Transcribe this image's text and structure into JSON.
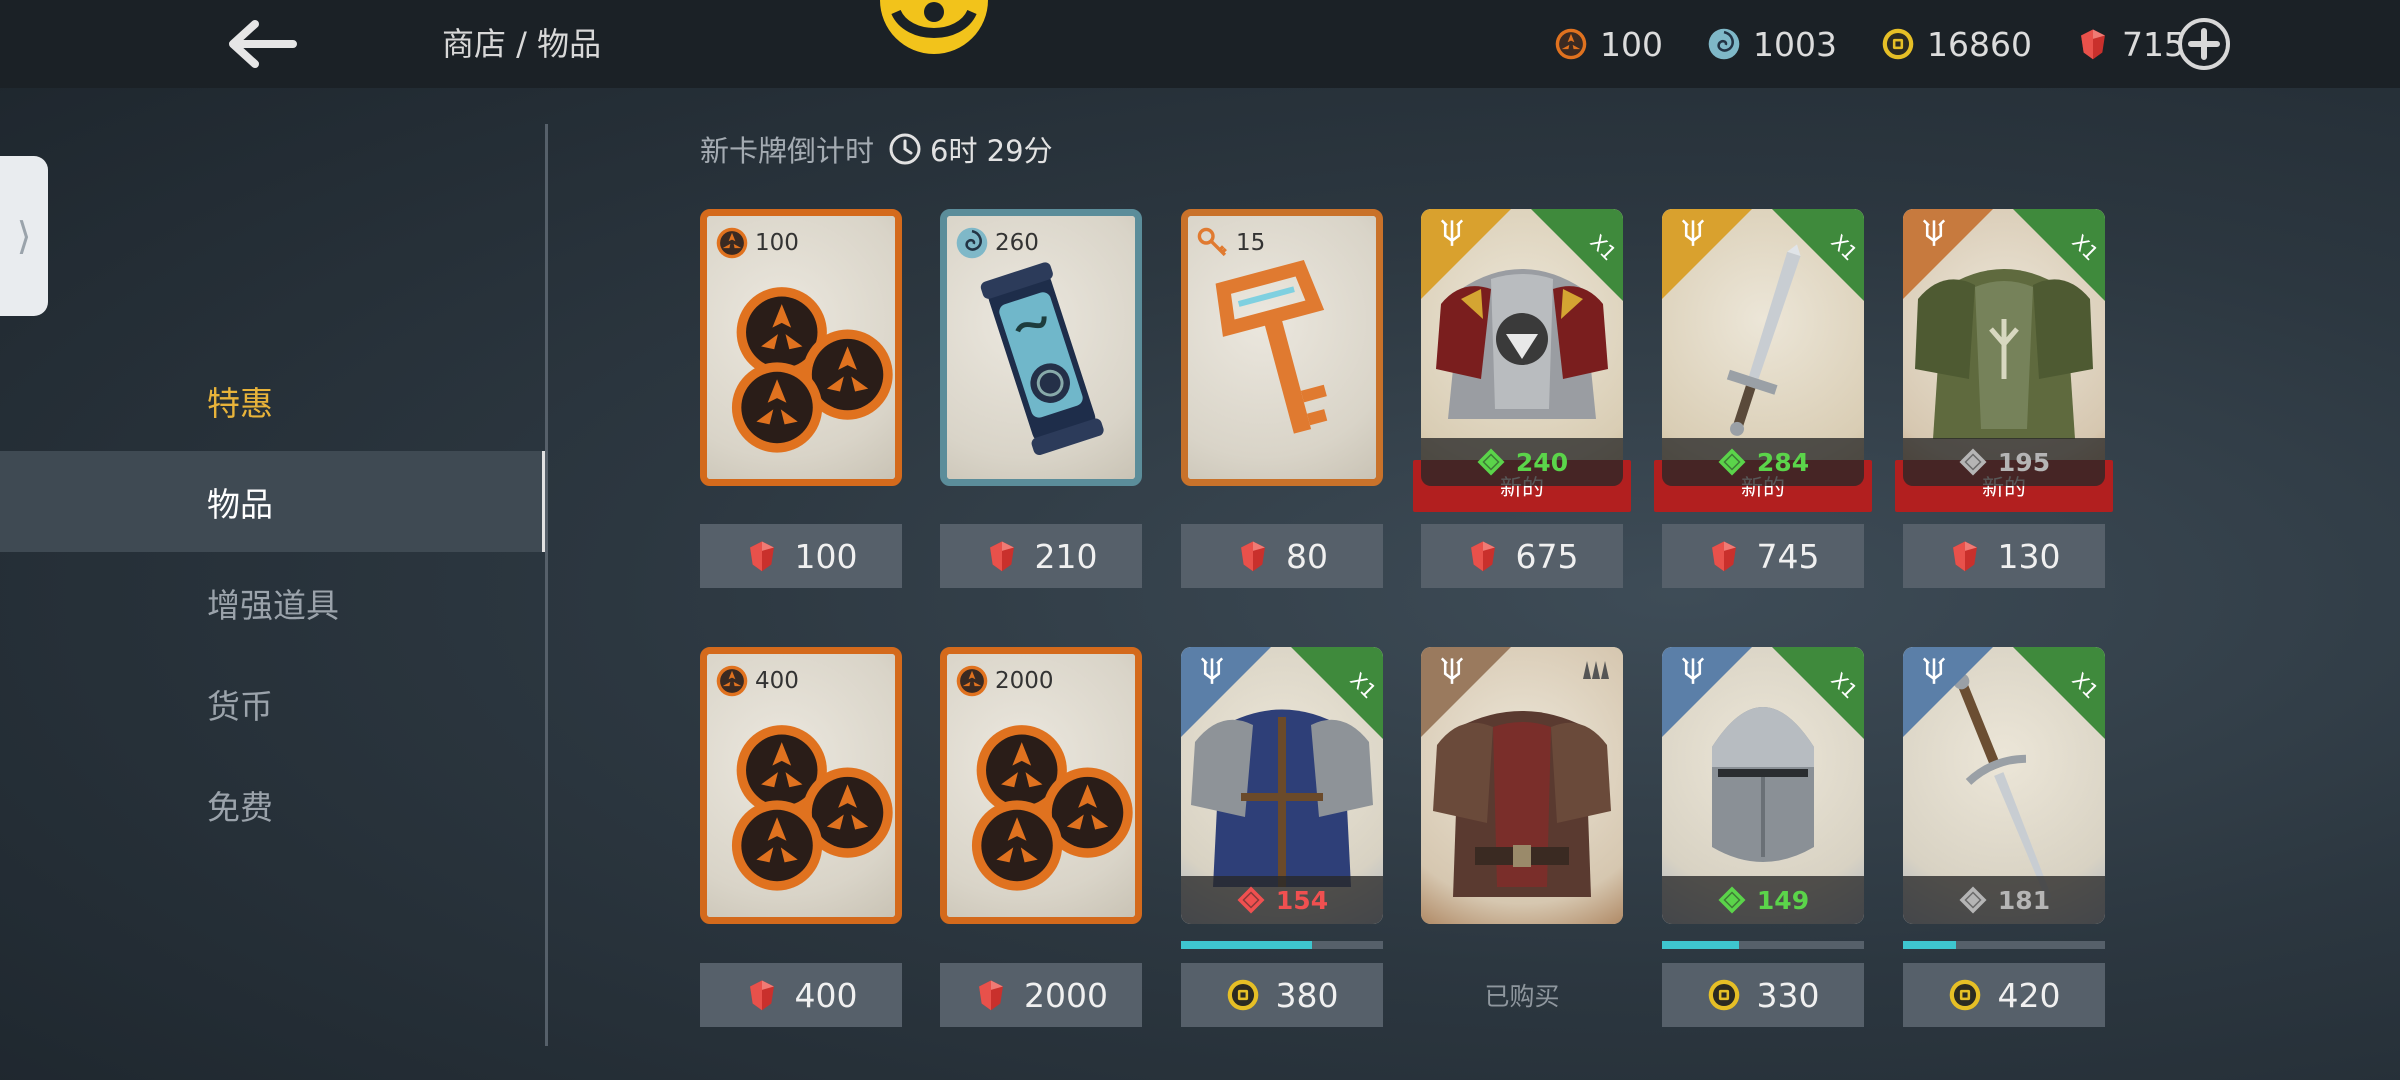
{
  "header": {
    "breadcrumb": "商店 / 物品",
    "currencies": [
      {
        "icon": "orange-shard-icon",
        "value": "100",
        "color": "#e0721f"
      },
      {
        "icon": "blue-orb-icon",
        "value": "1003",
        "color": "#7fb8c8"
      },
      {
        "icon": "gold-coin-icon",
        "value": "16860",
        "color": "#e6bf26"
      },
      {
        "icon": "ruby-gem-icon",
        "value": "715",
        "color": "#c9302c"
      }
    ]
  },
  "sidebar": {
    "items": [
      {
        "label": "特惠"
      },
      {
        "label": "物品"
      },
      {
        "label": "增强道具"
      },
      {
        "label": "货币"
      },
      {
        "label": "免费"
      }
    ]
  },
  "countdown": {
    "label": "新卡牌倒计时",
    "time": "6时 29分"
  },
  "colors": {
    "accent": "#e8b33a",
    "power_green": "#5bd44a",
    "power_red": "#f05050",
    "power_gray": "#b5b5b5",
    "new_tag": "#b21f1f",
    "progress": "#3ec6cf"
  },
  "cards": [
    {
      "item": "orange-shards",
      "top_icon": "orange-shard-icon",
      "top_value": "100",
      "price": "100",
      "price_icon": "ruby-gem-icon"
    },
    {
      "item": "energy-canister",
      "top_icon": "blue-orb-icon",
      "top_value": "260",
      "price": "210",
      "price_icon": "ruby-gem-icon"
    },
    {
      "item": "orange-key",
      "top_icon": "key-icon",
      "top_value": "15",
      "price": "80",
      "price_icon": "ruby-gem-icon"
    },
    {
      "item": "lion-armor",
      "badge": "X1",
      "power": "240",
      "power_color": "green",
      "tag": "新的",
      "price": "675",
      "price_icon": "ruby-gem-icon"
    },
    {
      "item": "short-sword",
      "badge": "X1",
      "power": "284",
      "power_color": "green",
      "tag": "新的",
      "price": "745",
      "price_icon": "ruby-gem-icon"
    },
    {
      "item": "green-armor",
      "badge": "X1",
      "power": "195",
      "power_color": "gray",
      "tag": "新的",
      "price": "130",
      "price_icon": "ruby-gem-icon"
    },
    {
      "item": "orange-shards",
      "top_icon": "orange-shard-icon",
      "top_value": "400",
      "price": "400",
      "price_icon": "ruby-gem-icon"
    },
    {
      "item": "orange-shards",
      "top_icon": "orange-shard-icon",
      "top_value": "2000",
      "price": "2000",
      "price_icon": "ruby-gem-icon"
    },
    {
      "item": "blue-armor",
      "badge": "X1",
      "power": "154",
      "power_color": "red",
      "progress": 0.65,
      "price": "380",
      "price_icon": "gold-coin-icon"
    },
    {
      "item": "leather-armor",
      "power": null,
      "status": "已购买"
    },
    {
      "item": "knight-helmet",
      "badge": "X1",
      "power": "149",
      "power_color": "green",
      "progress": 0.38,
      "price": "330",
      "price_icon": "gold-coin-icon"
    },
    {
      "item": "longsword",
      "badge": "X1",
      "power": "181",
      "power_color": "gray",
      "progress": 0.26,
      "price": "420",
      "price_icon": "gold-coin-icon"
    }
  ]
}
